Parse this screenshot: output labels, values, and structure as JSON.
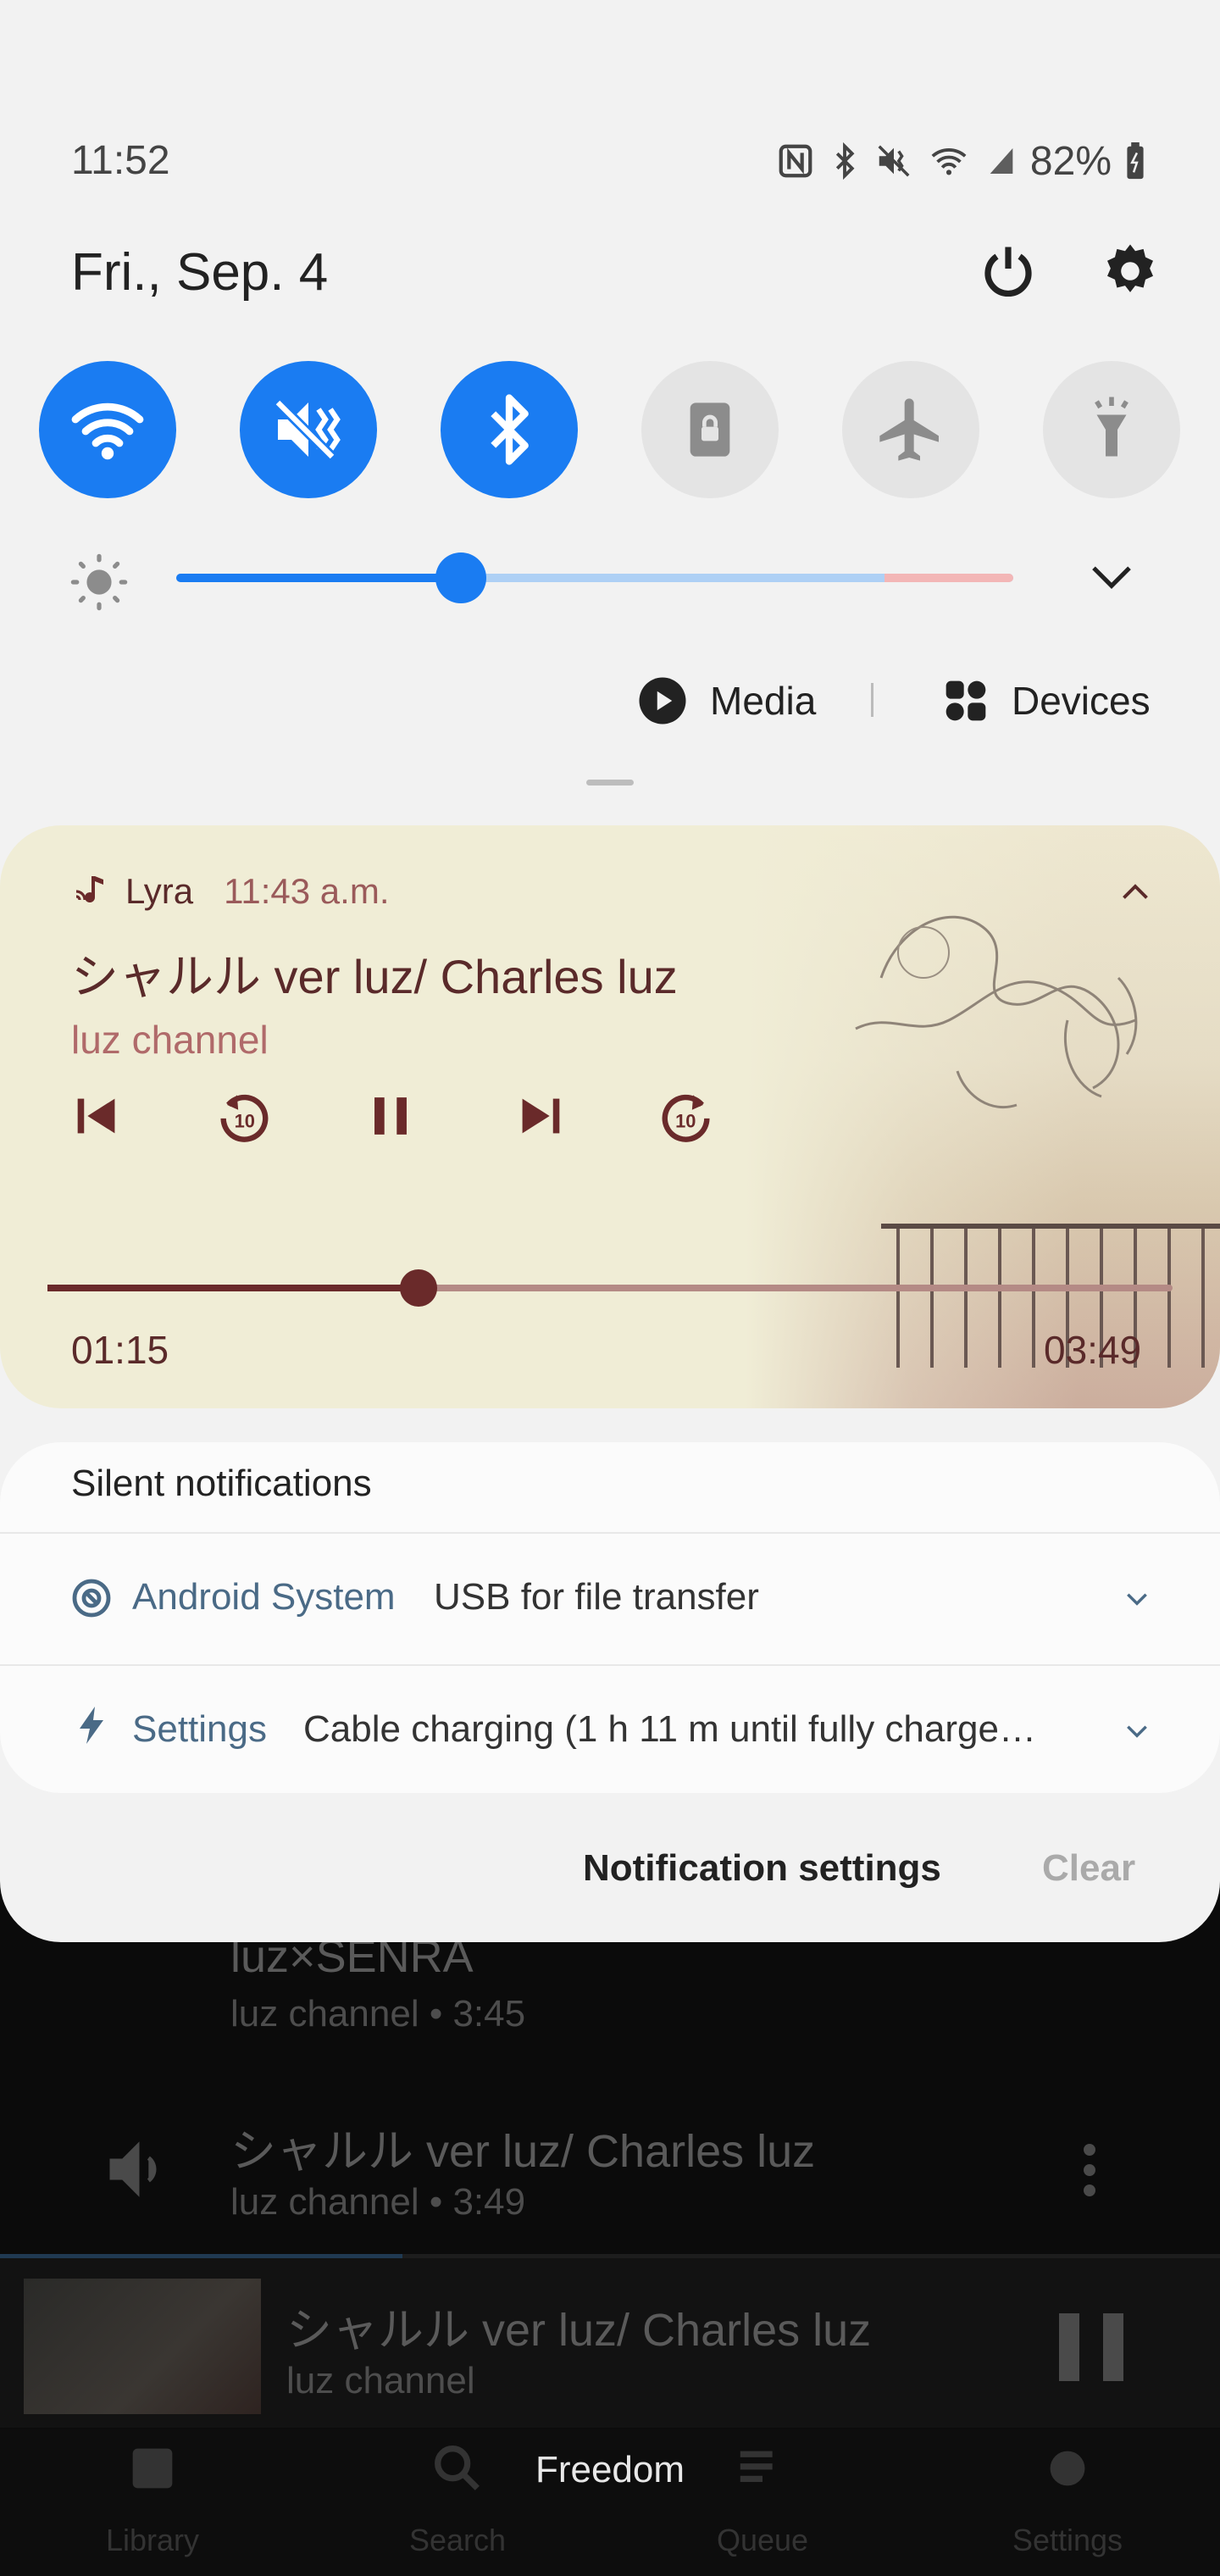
{
  "status_bar": {
    "time": "11:52",
    "battery": "82%",
    "icons": [
      "nfc-icon",
      "bluetooth-icon",
      "vibrate-mute-icon",
      "wifi-icon",
      "signal-icon",
      "battery-charging-icon"
    ]
  },
  "header": {
    "date": "Fri., Sep. 4",
    "icons": [
      "power-icon",
      "gear-icon"
    ]
  },
  "quick_settings": [
    {
      "name": "wifi",
      "icon": "wifi-icon",
      "active": true
    },
    {
      "name": "sound",
      "icon": "mute-icon",
      "active": true
    },
    {
      "name": "bluetooth",
      "icon": "bluetooth-icon",
      "active": true
    },
    {
      "name": "rotation-lock",
      "icon": "lock-icon",
      "active": false
    },
    {
      "name": "airplane-mode",
      "icon": "airplane-icon",
      "active": false
    },
    {
      "name": "flashlight",
      "icon": "flashlight-icon",
      "active": false
    }
  ],
  "brightness": {
    "level": 0.34
  },
  "media_output": {
    "media_label": "Media",
    "devices_label": "Devices"
  },
  "media_player": {
    "app_name": "Lyra",
    "posted_time": "11:43 a.m.",
    "title": "シャルル ver luz/ Charles luz",
    "artist": "luz channel",
    "elapsed": "01:15",
    "duration": "03:49",
    "progress": 0.33,
    "controls": [
      "previous-icon",
      "rewind-10-icon",
      "pause-icon",
      "next-icon",
      "forward-10-icon"
    ],
    "colors": {
      "accent": "#6a2a2a",
      "background": "#f0edd6"
    }
  },
  "silent_notifications": {
    "header": "Silent notifications",
    "items": [
      {
        "app": "Android System",
        "text": "USB for file transfer",
        "icon": "android-system-icon"
      },
      {
        "app": "Settings",
        "text": "Cable charging (1 h 11 m until fully charge…",
        "icon": "charging-bolt-icon"
      }
    ]
  },
  "footer": {
    "notification_settings": "Notification settings",
    "clear": "Clear"
  },
  "background_app": {
    "rows": [
      {
        "title": "luz×SENRA",
        "subtitle": "luz channel • 3:45"
      },
      {
        "title": "シャルル ver luz/ Charles luz",
        "subtitle": "luz channel • 3:49"
      }
    ],
    "now_playing": {
      "title": "シャルル ver luz/ Charles luz",
      "artist": "luz channel",
      "progress": 0.33
    },
    "nav": [
      "Library",
      "Search",
      "Queue",
      "Settings"
    ],
    "toast": "Freedom"
  }
}
